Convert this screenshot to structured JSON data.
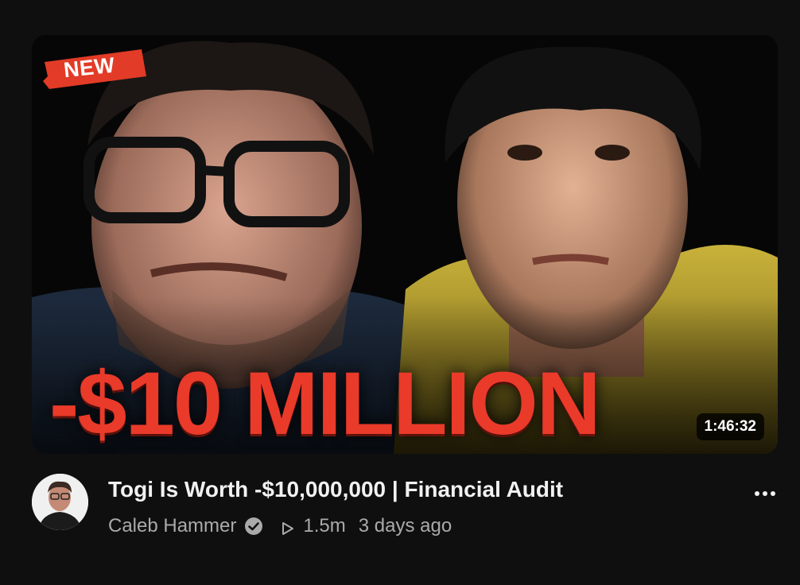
{
  "video": {
    "badge_label": "NEW",
    "thumbnail_headline": "-$10 MILLION",
    "duration": "1:46:32",
    "title": "Togi Is Worth -$10,000,000 | Financial Audit",
    "channel": "Caleb Hammer",
    "views": "1.5m",
    "age": "3 days ago"
  },
  "icons": {
    "verified": "verified-check-icon",
    "views": "play-outline-icon",
    "more": "more-horizontal-icon"
  },
  "colors": {
    "background": "#0f0f0f",
    "accent_red": "#ea3a2a",
    "title_text": "#f1f1f1",
    "meta_text": "#aaaaaa"
  }
}
